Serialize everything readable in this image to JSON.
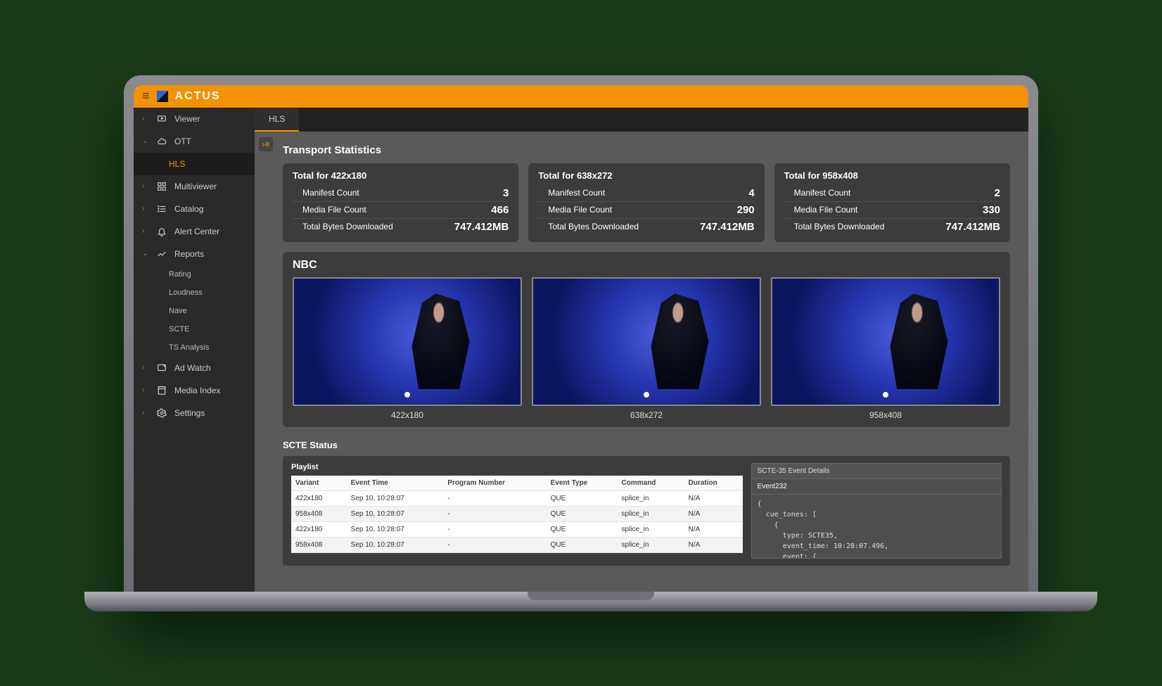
{
  "brand": "ACTUS",
  "sidebar": {
    "items": [
      {
        "label": "Viewer",
        "chev": ">"
      },
      {
        "label": "OTT",
        "chev": "v"
      },
      {
        "label": "HLS",
        "sub_active": true
      },
      {
        "label": "Multiviewer",
        "chev": ">"
      },
      {
        "label": "Catalog",
        "chev": ">"
      },
      {
        "label": "Alert Center",
        "chev": ">"
      },
      {
        "label": "Reports",
        "chev": "v"
      },
      {
        "label": "Rating",
        "sub": true
      },
      {
        "label": "Loudness",
        "sub": true
      },
      {
        "label": "Nave",
        "sub": true
      },
      {
        "label": "SCTE",
        "sub": true
      },
      {
        "label": "TS Analysis",
        "sub": true
      },
      {
        "label": "Ad Watch",
        "chev": ">"
      },
      {
        "label": "Media Index",
        "chev": ">"
      },
      {
        "label": "Settings",
        "chev": ">"
      }
    ]
  },
  "tabs": [
    {
      "label": "HLS",
      "active": true
    }
  ],
  "transport": {
    "title": "Transport Statistics",
    "cards": [
      {
        "heading": "Total for 422x180",
        "rows": [
          {
            "label": "Manifest Count",
            "value": "3"
          },
          {
            "label": "Media File Count",
            "value": "466"
          },
          {
            "label": "Total Bytes Downloaded",
            "value": "747.412MB"
          }
        ]
      },
      {
        "heading": "Total for 638x272",
        "rows": [
          {
            "label": "Manifest Count",
            "value": "4"
          },
          {
            "label": "Media File Count",
            "value": "290"
          },
          {
            "label": "Total Bytes Downloaded",
            "value": "747.412MB"
          }
        ]
      },
      {
        "heading": "Total for 958x408",
        "rows": [
          {
            "label": "Manifest Count",
            "value": "2"
          },
          {
            "label": "Media File Count",
            "value": "330"
          },
          {
            "label": "Total Bytes Downloaded",
            "value": "747.412MB"
          }
        ]
      }
    ]
  },
  "channel": {
    "name": "NBC",
    "thumbs": [
      "422x180",
      "638x272",
      "958x408"
    ]
  },
  "scte": {
    "title": "SCTE Status",
    "playlist_label": "Playlist",
    "columns": [
      "Variant",
      "Event Time",
      "Program Number",
      "Event Type",
      "Command",
      "Duration"
    ],
    "rows": [
      [
        "422x180",
        "Sep 10, 10:28:07",
        "-",
        "QUE",
        "splice_in",
        "N/A"
      ],
      [
        "958x408",
        "Sep 10, 10:28:07",
        "-",
        "QUE",
        "splice_in",
        "N/A"
      ],
      [
        "422x180",
        "Sep 10, 10:28:07",
        "-",
        "QUE",
        "splice_in",
        "N/A"
      ],
      [
        "958x408",
        "Sep 10, 10:28:07",
        "-",
        "QUE",
        "splice_in",
        "N/A"
      ]
    ],
    "details": {
      "header": "SCTE-35 Event Details",
      "event_name": "Event232",
      "code": "{\n  cue_tones: [\n    {\n      type: SCTE35,\n      event_time: 10:28:07.496,\n      event: {"
    }
  }
}
